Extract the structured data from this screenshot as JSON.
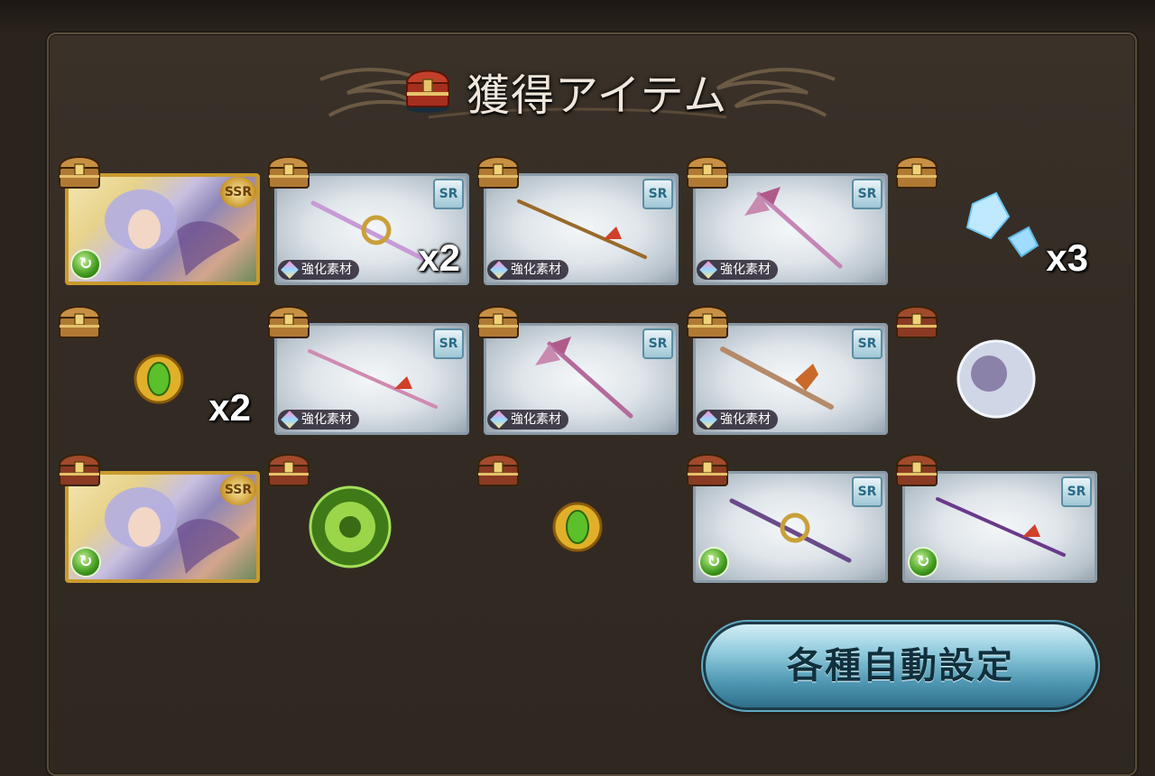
{
  "header": {
    "title": "獲得アイテム"
  },
  "labels": {
    "enhance_material": "強化素材",
    "ssr_badge": "SSR",
    "sr_badge": "SR"
  },
  "items": [
    {
      "kind": "character",
      "rarity": "SSR",
      "element": "wind",
      "quantity": ""
    },
    {
      "kind": "weapon",
      "rarity": "SR",
      "tag": "強化素材",
      "quantity": "x2",
      "color": "#c79bd6"
    },
    {
      "kind": "weapon",
      "rarity": "SR",
      "tag": "強化素材",
      "quantity": "",
      "color": "#9a6a2a"
    },
    {
      "kind": "weapon",
      "rarity": "SR",
      "tag": "強化素材",
      "quantity": "",
      "color": "#c486b6"
    },
    {
      "kind": "material",
      "icon": "ice-crystal",
      "quantity": "x3"
    },
    {
      "kind": "material",
      "icon": "wind-orb",
      "quantity": "x2"
    },
    {
      "kind": "weapon",
      "rarity": "SR",
      "tag": "強化素材",
      "quantity": "",
      "color": "#d08ab0"
    },
    {
      "kind": "weapon",
      "rarity": "SR",
      "tag": "強化素材",
      "quantity": "",
      "color": "#b46a9c"
    },
    {
      "kind": "weapon",
      "rarity": "SR",
      "tag": "強化素材",
      "quantity": "",
      "color": "#b48a6a"
    },
    {
      "kind": "material",
      "icon": "character-sphere",
      "quantity": ""
    },
    {
      "kind": "character",
      "rarity": "SSR",
      "element": "wind",
      "quantity": ""
    },
    {
      "kind": "material",
      "icon": "wind-clover-orb",
      "quantity": ""
    },
    {
      "kind": "material",
      "icon": "wind-orb",
      "quantity": ""
    },
    {
      "kind": "weapon",
      "rarity": "SR",
      "element": "wind",
      "quantity": "",
      "color": "#6a4a8a"
    },
    {
      "kind": "weapon",
      "rarity": "SR",
      "element": "wind",
      "quantity": "",
      "color": "#6a3a8a"
    }
  ],
  "actions": {
    "auto_settings": "各種自動設定"
  }
}
